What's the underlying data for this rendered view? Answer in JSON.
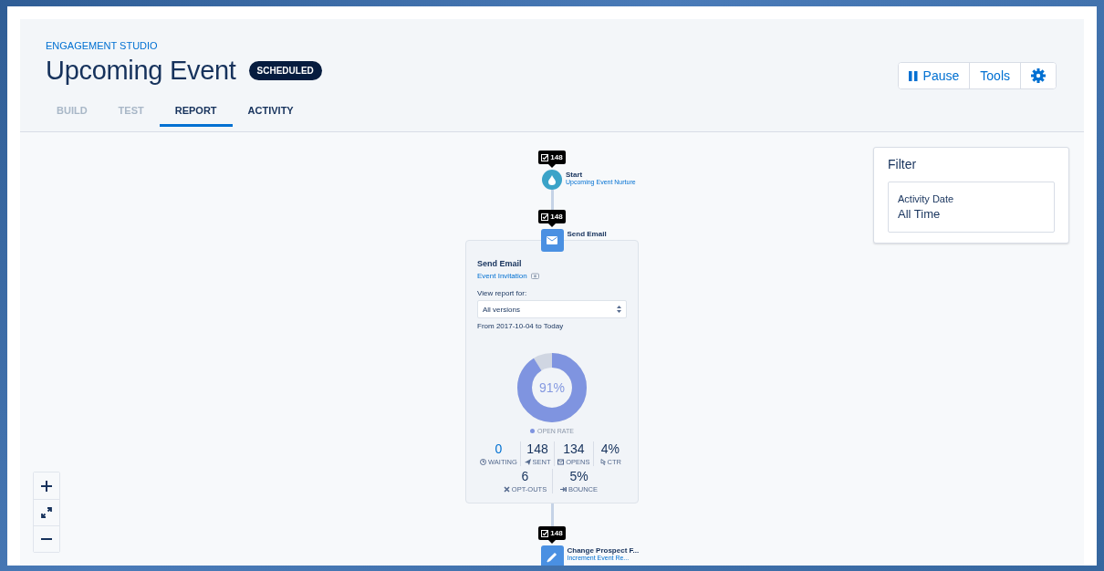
{
  "header": {
    "eyebrow": "ENGAGEMENT STUDIO",
    "title": "Upcoming Event",
    "status": "SCHEDULED"
  },
  "actions": [
    {
      "kind": "pause",
      "label": "Pause"
    },
    {
      "kind": "text",
      "label": "Tools"
    },
    {
      "kind": "settings"
    }
  ],
  "tabs": [
    {
      "label": "BUILD",
      "selected": false,
      "disabled": true
    },
    {
      "label": "TEST",
      "selected": false,
      "disabled": true
    },
    {
      "label": "REPORT",
      "selected": true,
      "disabled": false
    },
    {
      "label": "ACTIVITY",
      "selected": false,
      "disabled": false
    }
  ],
  "flow": [
    {
      "kind": "start",
      "count": "148",
      "title": "Start",
      "subtitle": "Upcoming Event Nurture"
    },
    {
      "kind": "email",
      "count": "148",
      "title": "Send Email"
    },
    {
      "kind": "action",
      "count": "148",
      "title": "Change Prospect F...",
      "subtitle": "Increment Event Re..."
    }
  ],
  "report_card": {
    "title": "Send Email",
    "link": "Event Invitation",
    "view_label": "View report for:",
    "select_value": "All versions",
    "date_range": "From 2017-10-04 to Today",
    "open_rate": {
      "level": 0.91,
      "reading": "91%",
      "label": "OPEN RATE"
    },
    "stats": [
      {
        "kind": "waiting",
        "value": "0",
        "label": "WAITING",
        "selected": true
      },
      {
        "kind": "sent",
        "value": "148",
        "label": "SENT",
        "selected": false
      },
      {
        "kind": "opens",
        "value": "134",
        "label": "OPENS",
        "selected": false
      },
      {
        "kind": "ctr",
        "value": "4%",
        "label": "CTR",
        "selected": false
      },
      {
        "kind": "optouts",
        "value": "6",
        "label": "OPT-OUTS",
        "selected": false
      },
      {
        "kind": "bounce",
        "value": "5%",
        "label": "BOUNCE",
        "selected": false
      }
    ]
  },
  "filter": {
    "title": "Filter",
    "field_label": "Activity Date",
    "field_value": "All Time"
  },
  "zoom_controls": [
    {
      "kind": "zoom-in"
    },
    {
      "kind": "fit"
    },
    {
      "kind": "zoom-out"
    }
  ]
}
